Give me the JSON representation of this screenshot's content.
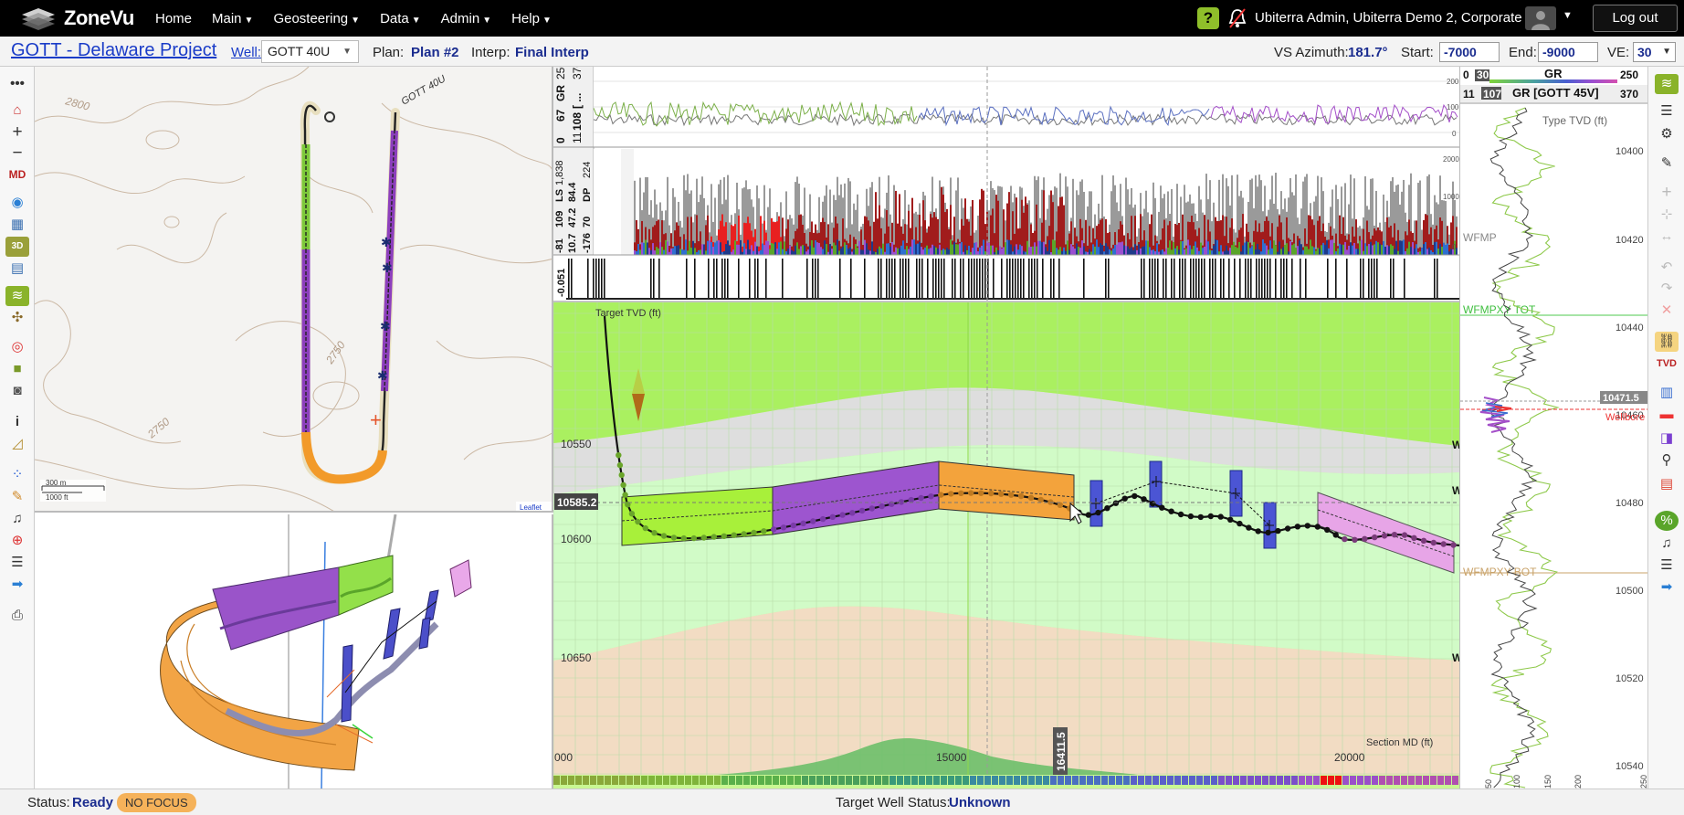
{
  "brand": {
    "name": "ZoneVu"
  },
  "nav": {
    "home": "Home",
    "main": "Main",
    "geosteering": "Geosteering",
    "data": "Data",
    "admin": "Admin",
    "help": "Help"
  },
  "user": {
    "name": "Ubiterra Admin, Ubiterra Demo 2, Corporate",
    "logout": "Log out"
  },
  "project": {
    "title": "GOTT - Delaware Project",
    "well_label": "Well:",
    "well_value": "GOTT 40U",
    "plan_label": "Plan:",
    "plan_value": "Plan #2",
    "interp_label": "Interp:",
    "interp_value": "Final Interp",
    "vs_label": "VS Azimuth:",
    "vs_value": "181.7°",
    "start_label": "Start:",
    "start_value": "-7000",
    "end_label": "End:",
    "end_value": "-9000",
    "ve_label": "VE:",
    "ve_value": "30"
  },
  "map": {
    "contours": [
      "2800",
      "2750",
      "2750"
    ],
    "well_name": "GOTT 40U",
    "scale_m": "300 m",
    "scale_ft": "1000 ft",
    "attribution": "Leaflet"
  },
  "xsection": {
    "gr_track": {
      "label": "GR",
      "left_min": "0",
      "left_val": "67",
      "right_min": "11",
      "right_val": "108",
      "bracket": "[ ...",
      "max": "250",
      "max2": "370"
    },
    "ls_track": {
      "labels": [
        "LS",
        "109",
        "10.7",
        "47.2",
        "DP",
        "-81",
        "-176",
        "84.4",
        "70",
        "1,838",
        "224"
      ]
    },
    "third_track": {
      "label": "-0.051"
    },
    "gr_axis": [
      "200",
      "100",
      "0"
    ],
    "ls_axis": [
      "2000",
      "1000",
      "0"
    ],
    "target_label": "Target TVD (ft)",
    "depth_ticks": [
      "10550",
      "10600",
      "10650"
    ],
    "current_tvd": "10585.2",
    "section_label": "Section MD (ft)",
    "md_ticks": [
      "000",
      "15000",
      "20000"
    ],
    "cursor_md": "16411.5",
    "edge_mark": "W"
  },
  "typelog": {
    "gr_min": "0",
    "gr_sel": "30",
    "gr_name": "GR",
    "gr_max": "250",
    "gr2_min": "11",
    "gr2_sel": "107",
    "gr2_name": "GR [GOTT 45V]",
    "gr2_max": "370",
    "axis_title": "Type TVD (ft)",
    "depths": [
      "10400",
      "10420",
      "10440",
      "10460",
      "10480",
      "10500",
      "10520",
      "10540"
    ],
    "cursor_depth": "10471.5",
    "wellbore": "Wellbore",
    "formations": [
      "WFMP",
      "WFMPXY TOT",
      "WFMPXY BOT"
    ],
    "bottom_ticks": [
      "50",
      "100",
      "150",
      "200",
      "250"
    ]
  },
  "status": {
    "status_label": "Status:",
    "status_value": "Ready",
    "focus_badge": "NO FOCUS",
    "target_label": "Target Well Status:",
    "target_value": "Unknown"
  },
  "colors": {
    "topbar": "#000000",
    "link": "#1a3cc8",
    "value": "#1a2c8f",
    "green_zone": "#a8f070",
    "purple_zone": "#9c4fc9",
    "orange_zone": "#f2a33a",
    "pink_zone": "#e9a8e9",
    "blue_marker": "#4f5fd0",
    "badge": "#f5b25a"
  }
}
